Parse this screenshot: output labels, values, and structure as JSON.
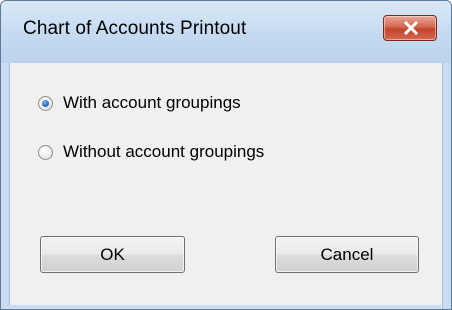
{
  "window": {
    "title": "Chart of Accounts Printout",
    "close_icon": "close-icon"
  },
  "options": [
    {
      "label": "With account groupings",
      "selected": true
    },
    {
      "label": "Without account groupings",
      "selected": false
    }
  ],
  "buttons": {
    "ok_label": "OK",
    "cancel_label": "Cancel"
  },
  "colors": {
    "titlebar": "#c4daf1",
    "close_button": "#c2452a",
    "client_background": "#f0f0f0",
    "radio_accent": "#2a6fc0"
  }
}
